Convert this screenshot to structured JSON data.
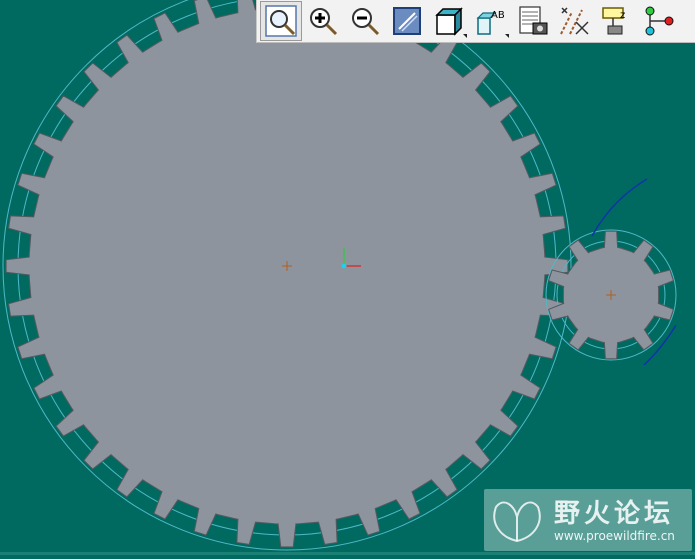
{
  "app": {
    "viewport_background": "#006a60",
    "gear_fill": "#8e949d",
    "gear_outline": "#555a60",
    "circle_color": "#4fb8c8"
  },
  "toolbar": {
    "buttons": [
      {
        "name": "zoom-fit-button",
        "icon": "zoom-fit-icon",
        "active": true
      },
      {
        "name": "zoom-in-button",
        "icon": "zoom-in-icon"
      },
      {
        "name": "zoom-out-button",
        "icon": "zoom-out-icon"
      },
      {
        "name": "repaint-button",
        "icon": "repaint-icon"
      },
      {
        "name": "display-style-button",
        "icon": "shaded-box-icon",
        "dropdown": true
      },
      {
        "name": "saved-views-button",
        "icon": "named-view-icon",
        "dropdown": true
      },
      {
        "name": "view-manager-button",
        "icon": "view-manager-icon"
      },
      {
        "name": "datum-display-button",
        "icon": "datum-axes-icon"
      },
      {
        "name": "layer-settings-button",
        "icon": "layers-icon"
      },
      {
        "name": "model-tree-button",
        "icon": "tree-nodes-icon"
      }
    ]
  },
  "watermark": {
    "title": "野火论坛",
    "url": "www.proewildfire.cn"
  }
}
